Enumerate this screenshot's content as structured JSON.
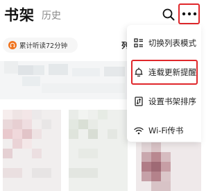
{
  "header": {
    "tabs": [
      {
        "label": "书架",
        "active": true
      },
      {
        "label": "历史",
        "active": false
      }
    ],
    "search_icon": "search-icon",
    "more_icon": "more-horizontal-icon"
  },
  "listen_pill": {
    "icon": "headphones-icon",
    "text": "累计听读72分钟"
  },
  "list_label_fragment": "列",
  "menu": {
    "items": [
      {
        "label": "切换列表模式",
        "icon": "list-view-icon",
        "highlighted": false
      },
      {
        "label": "连载更新提醒",
        "icon": "bell-icon",
        "highlighted": true
      },
      {
        "label": "设置书架排序",
        "icon": "sort-icon",
        "highlighted": false
      },
      {
        "label": "Wi-Fi传书",
        "icon": "wifi-icon",
        "highlighted": false
      }
    ]
  },
  "colors": {
    "highlight_border": "#e0272b",
    "pill_icon": "#f0741f",
    "inactive_tab": "#8a8a8a"
  }
}
